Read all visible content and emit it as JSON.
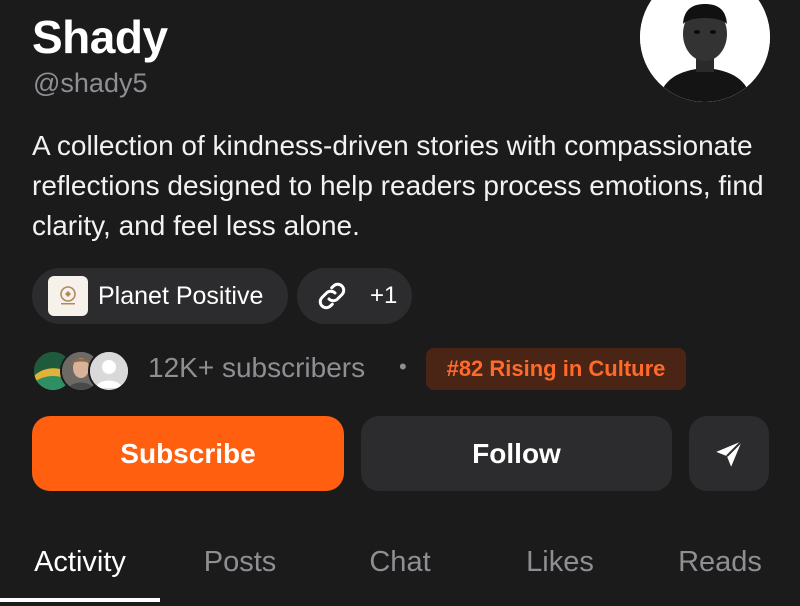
{
  "profile": {
    "name": "Shady",
    "handle": "@shady5",
    "bio": "A collection of kindness-driven stories with compassionate reflections designed to help readers process emotions, find clarity, and feel less alone."
  },
  "chips": {
    "publication": "Planet Positive",
    "links_count": "+1",
    "link_icon": "link-icon"
  },
  "stats": {
    "subscribers": "12K+ subscribers",
    "separator": "•",
    "rank": "#82 Rising in Culture"
  },
  "actions": {
    "subscribe": "Subscribe",
    "follow": "Follow",
    "share_icon": "send-icon"
  },
  "tabs": [
    "Activity",
    "Posts",
    "Chat",
    "Likes",
    "Reads"
  ],
  "active_tab": "Activity",
  "colors": {
    "background": "#1b1b1c",
    "accent": "#ff5f0f",
    "muted": "#8e8e93",
    "surface": "#2c2c2e",
    "rank_bg": "#4a2414",
    "rank_text": "#ff6a2a"
  }
}
